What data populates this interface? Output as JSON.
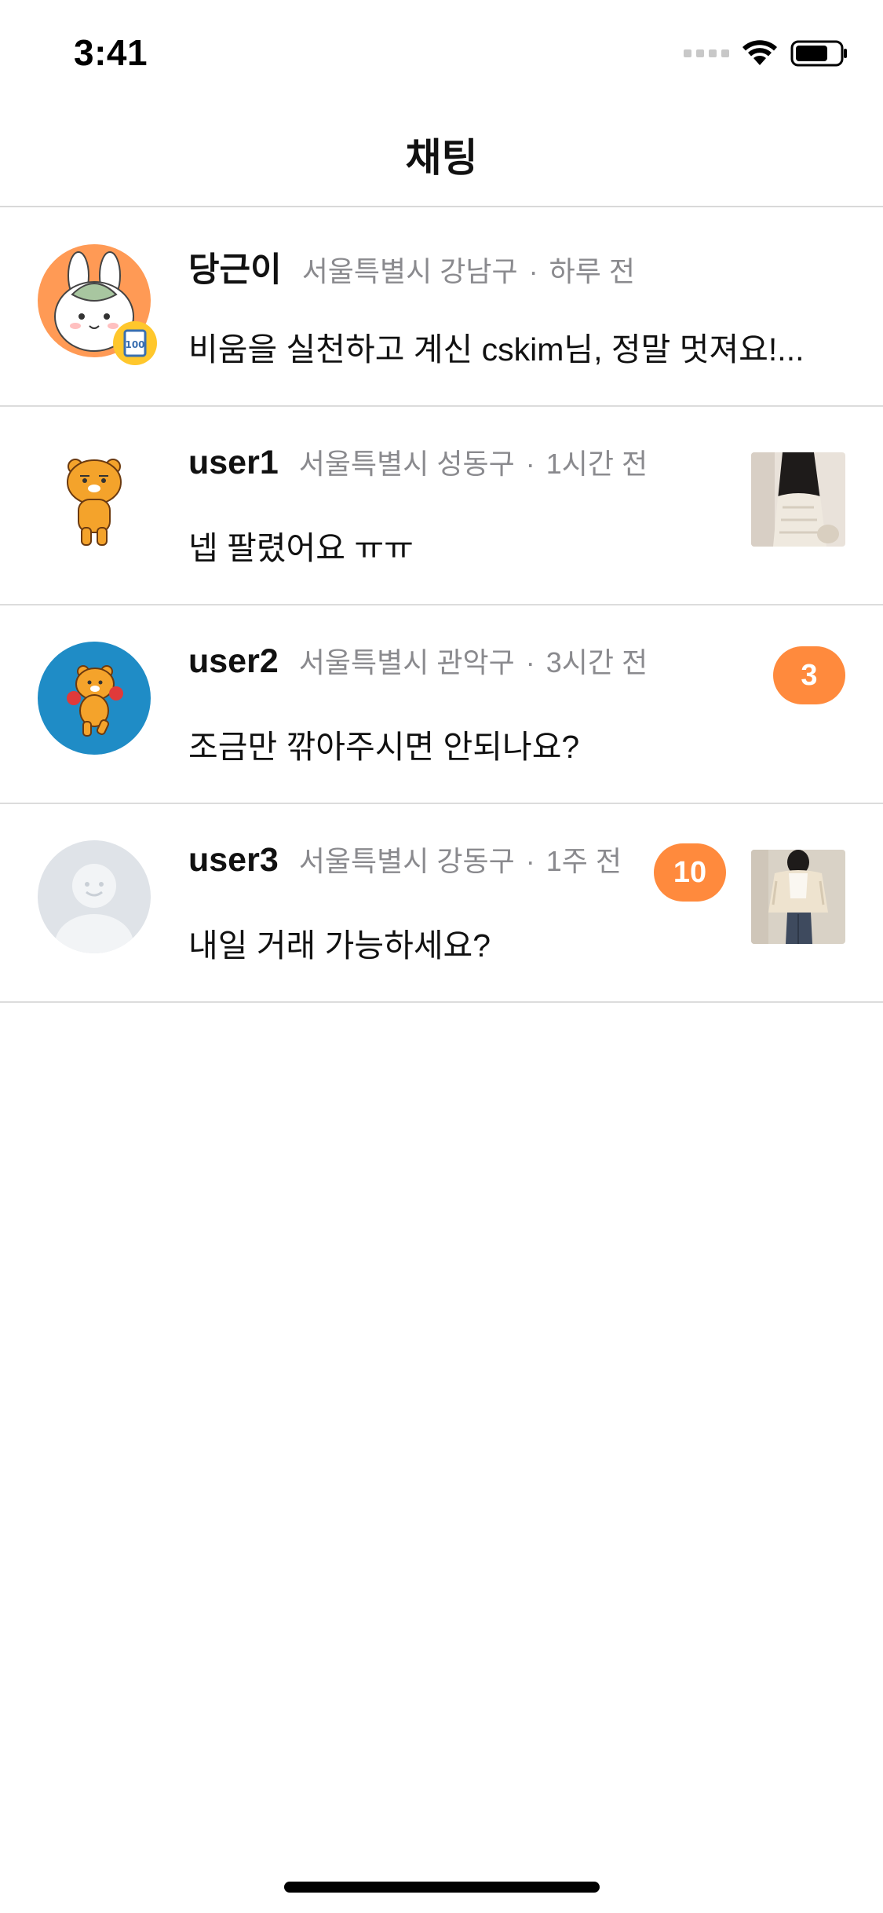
{
  "status_bar": {
    "time": "3:41",
    "icons": [
      "signal-icon",
      "wifi-icon",
      "battery-icon"
    ]
  },
  "nav": {
    "title": "채팅"
  },
  "chats": [
    {
      "name": "당근이",
      "location": "서울특별시 강남구",
      "time": "하루 전",
      "message": "비움을 실천하고 계신 cskim님, 정말 멋져요!...",
      "avatar": "bunny-avatar-icon",
      "unread": null,
      "has_thumbnail": false
    },
    {
      "name": "user1",
      "location": "서울특별시 성동구",
      "time": "1시간 전",
      "message": "넵 팔렸어요 ㅠㅠ",
      "avatar": "bear-avatar-icon",
      "unread": null,
      "has_thumbnail": true
    },
    {
      "name": "user2",
      "location": "서울특별시 관악구",
      "time": "3시간 전",
      "message": "조금만 깎아주시면 안되나요?",
      "avatar": "bear-boxing-avatar-icon",
      "unread": "3",
      "has_thumbnail": false
    },
    {
      "name": "user3",
      "location": "서울특별시 강동구",
      "time": "1주 전",
      "message": "내일 거래 가능하세요?",
      "avatar": "default-person-avatar-icon",
      "unread": "10",
      "has_thumbnail": true
    }
  ],
  "separator": "·",
  "colors": {
    "accent": "#ff8a3d",
    "meta_text": "#8a8a8e",
    "divider": "#dcdcdc"
  }
}
